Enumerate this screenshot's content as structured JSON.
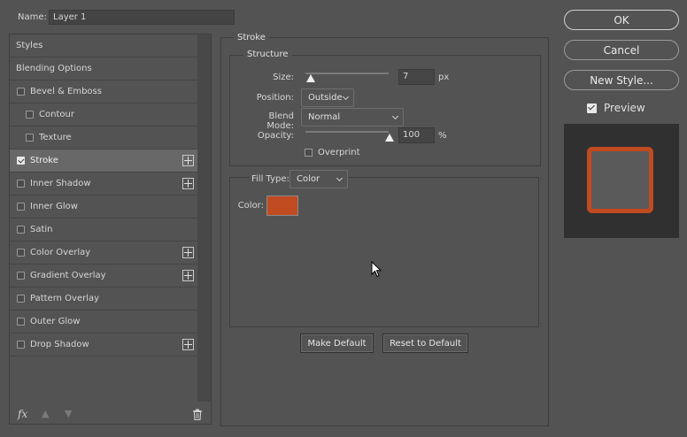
{
  "name": {
    "label": "Name:",
    "value": "Layer 1"
  },
  "styles": {
    "items": [
      {
        "label": "Styles",
        "checkbox": false,
        "checked": false,
        "indent": false,
        "plus": false,
        "selected": false
      },
      {
        "label": "Blending Options",
        "checkbox": false,
        "checked": false,
        "indent": false,
        "plus": false,
        "selected": false
      },
      {
        "label": "Bevel & Emboss",
        "checkbox": true,
        "checked": false,
        "indent": false,
        "plus": false,
        "selected": false
      },
      {
        "label": "Contour",
        "checkbox": true,
        "checked": false,
        "indent": true,
        "plus": false,
        "selected": false
      },
      {
        "label": "Texture",
        "checkbox": true,
        "checked": false,
        "indent": true,
        "plus": false,
        "selected": false
      },
      {
        "label": "Stroke",
        "checkbox": true,
        "checked": true,
        "indent": false,
        "plus": true,
        "selected": true
      },
      {
        "label": "Inner Shadow",
        "checkbox": true,
        "checked": false,
        "indent": false,
        "plus": true,
        "selected": false
      },
      {
        "label": "Inner Glow",
        "checkbox": true,
        "checked": false,
        "indent": false,
        "plus": false,
        "selected": false
      },
      {
        "label": "Satin",
        "checkbox": true,
        "checked": false,
        "indent": false,
        "plus": false,
        "selected": false
      },
      {
        "label": "Color Overlay",
        "checkbox": true,
        "checked": false,
        "indent": false,
        "plus": true,
        "selected": false
      },
      {
        "label": "Gradient Overlay",
        "checkbox": true,
        "checked": false,
        "indent": false,
        "plus": true,
        "selected": false
      },
      {
        "label": "Pattern Overlay",
        "checkbox": true,
        "checked": false,
        "indent": false,
        "plus": false,
        "selected": false
      },
      {
        "label": "Outer Glow",
        "checkbox": true,
        "checked": false,
        "indent": false,
        "plus": false,
        "selected": false
      },
      {
        "label": "Drop Shadow",
        "checkbox": true,
        "checked": false,
        "indent": false,
        "plus": true,
        "selected": false
      }
    ],
    "footer": {
      "fx": "fx"
    }
  },
  "stroke": {
    "title": "Stroke",
    "structure": {
      "title": "Structure",
      "size": {
        "label": "Size:",
        "value": "7",
        "unit": "px"
      },
      "position": {
        "label": "Position:",
        "value": "Outside"
      },
      "blend_mode": {
        "label": "Blend Mode:",
        "value": "Normal"
      },
      "opacity": {
        "label": "Opacity:",
        "value": "100",
        "unit": "%"
      },
      "overprint": {
        "label": "Overprint",
        "checked": false
      }
    },
    "fill": {
      "type_label": "Fill Type:",
      "type_value": "Color",
      "color_label": "Color:",
      "color": "#c14b21"
    },
    "make_default": "Make Default",
    "reset_default": "Reset to Default"
  },
  "buttons": {
    "ok": "OK",
    "cancel": "Cancel",
    "new_style": "New Style..."
  },
  "preview": {
    "label": "Preview",
    "checked": true,
    "stroke_color": "#c14b21"
  }
}
